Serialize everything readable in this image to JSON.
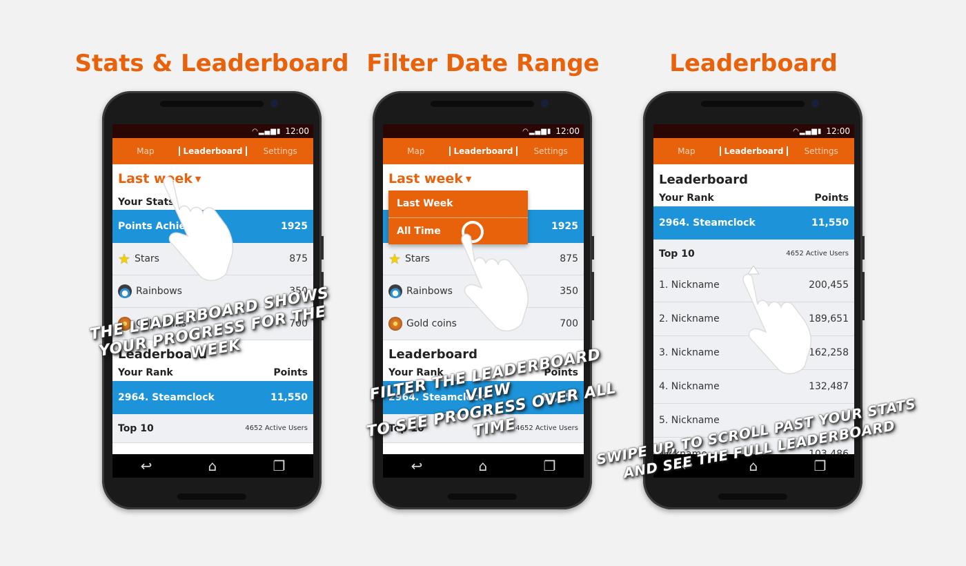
{
  "panels": [
    {
      "title": "Stats & Leaderboard"
    },
    {
      "title": "Filter Date Range"
    },
    {
      "title": "Leaderboard"
    }
  ],
  "status": {
    "time": "12:00"
  },
  "tabs": {
    "map": "Map",
    "leaderboard": "Leaderboard",
    "settings": "Settings"
  },
  "stats": {
    "filter_label": "Last week",
    "your_stats": "Your Stats",
    "points_label": "Points Achieved",
    "points_value": "1925",
    "items": [
      {
        "icon": "star-icon",
        "label": "Stars",
        "value": "875"
      },
      {
        "icon": "rainbow-icon",
        "label": "Rainbows",
        "value": "350"
      },
      {
        "icon": "gold-coin-icon",
        "label": "Gold coins",
        "value": "700"
      }
    ]
  },
  "leaderboard": {
    "title": "Leaderboard",
    "your_rank": "Your Rank",
    "points": "Points",
    "user_rank": "2964. Steamclock",
    "user_points": "11,550",
    "top10": "Top 10",
    "active_users": "4652 Active Users",
    "entries": [
      {
        "name": "1. Nickname",
        "points": "200,455"
      },
      {
        "name": "2. Nickname",
        "points": "189,651"
      },
      {
        "name": "3. Nickname",
        "points": "162,258"
      },
      {
        "name": "4. Nickname",
        "points": "132,487"
      },
      {
        "name": "5. Nickname",
        "points": ""
      },
      {
        "name": "Nickname",
        "points": "103,486"
      }
    ]
  },
  "dropdown": {
    "options": [
      "Last Week",
      "All Time"
    ]
  },
  "captions": {
    "c1_line1": "The leaderboard shows",
    "c1_line2": "your progress for the week",
    "c2_line1": "Filter the leaderboard view",
    "c2_line2": "to see progress over all time",
    "c3_line1": "Swipe up, to scroll past your stats",
    "c3_line2": "and see the full leaderboard"
  },
  "colors": {
    "accent": "#e8620c",
    "highlight": "#1d94da",
    "background": "#f2f2f2"
  }
}
